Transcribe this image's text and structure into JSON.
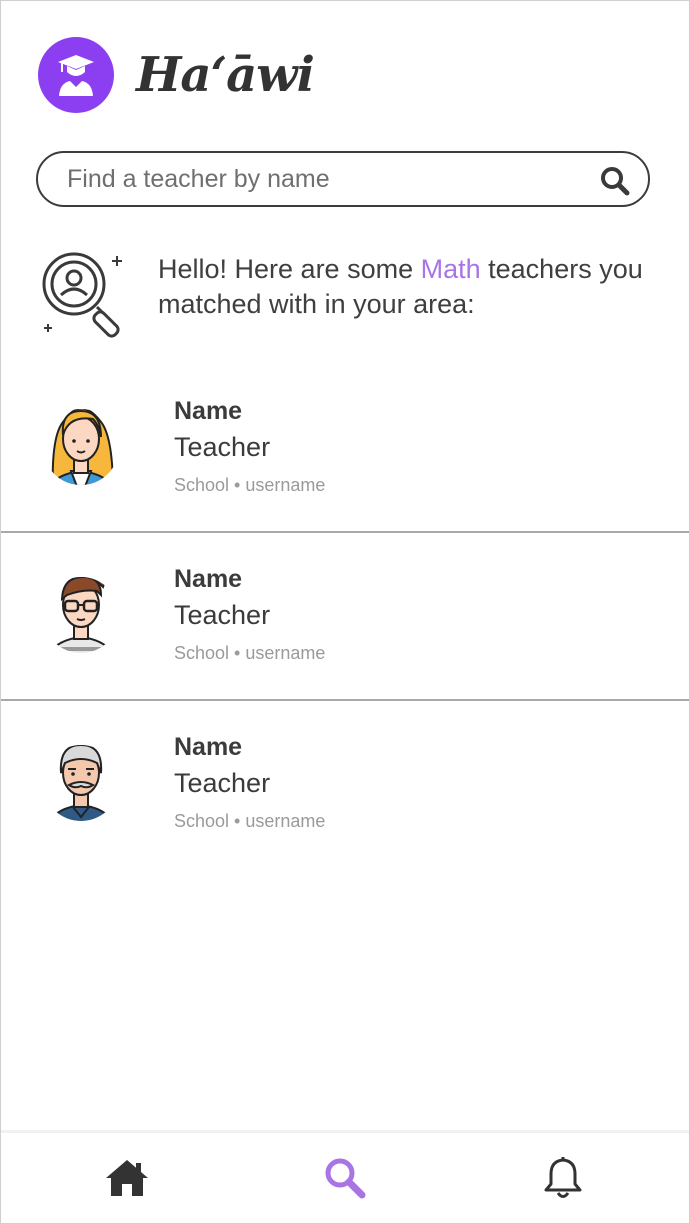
{
  "app": {
    "brand": "Haʻāwi"
  },
  "search": {
    "placeholder": "Find a teacher by name"
  },
  "intro": {
    "text_before": "Hello! Here are some ",
    "subject": "Math",
    "text_after": " teachers you matched with in your area:"
  },
  "teachers": [
    {
      "name": "Name",
      "role": "Teacher",
      "meta": "School • username",
      "avatar": "woman-teacher-avatar"
    },
    {
      "name": "Name",
      "role": "Teacher",
      "meta": "School • username",
      "avatar": "man-glasses-avatar"
    },
    {
      "name": "Name",
      "role": "Teacher",
      "meta": "School • username",
      "avatar": "older-man-avatar"
    }
  ],
  "bottom_nav": [
    {
      "id": "home",
      "icon": "home-icon",
      "active": false
    },
    {
      "id": "search",
      "icon": "search-icon",
      "active": true
    },
    {
      "id": "notifications",
      "icon": "bell-icon",
      "active": false
    }
  ],
  "colors": {
    "accent": "#8c3ff1",
    "subject": "#a874e6",
    "active_nav": "#a874e6",
    "inactive_nav": "#333333"
  }
}
